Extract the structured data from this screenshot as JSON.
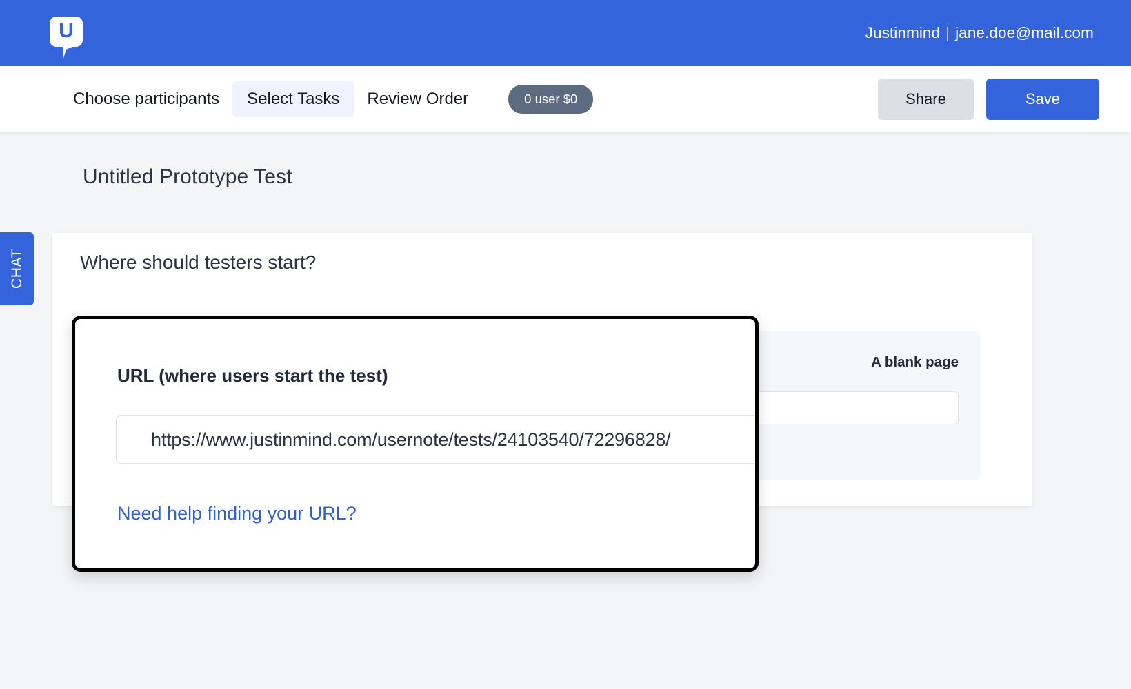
{
  "header": {
    "logo_icon": "justinmind-speech-bubble-logo",
    "logo_letter": "U",
    "brand": "Justinmind",
    "separator": "|",
    "user_email": "jane.doe@mail.com",
    "background_color": "#3464dc"
  },
  "subnav": {
    "steps": [
      {
        "label": "Choose participants",
        "active": false
      },
      {
        "label": "Select Tasks",
        "active": true
      },
      {
        "label": "Review Order",
        "active": false
      }
    ],
    "cost_badge": "0 user $0",
    "cost_badge_color": "#5d6b80",
    "share_label": "Share",
    "save_label": "Save",
    "save_color": "#3464dc",
    "share_color": "#dcdfe3"
  },
  "chat_tab": {
    "label": "CHAT",
    "color": "#3464dc"
  },
  "main": {
    "page_title": "Untitled Prototype Test",
    "card": {
      "question": "Where should testers start?",
      "option": {
        "label": "A blank page",
        "input_value": "",
        "background_color": "#f4f8fd"
      }
    }
  },
  "modal": {
    "heading": "URL (where users start the test)",
    "url_value": "https://www.justinmind.com/usernote/tests/24103540/72296828/",
    "url_placeholder": "https://",
    "help_link": "Need help finding your URL?",
    "help_link_color": "#2f62c8",
    "border_color": "#000000"
  }
}
